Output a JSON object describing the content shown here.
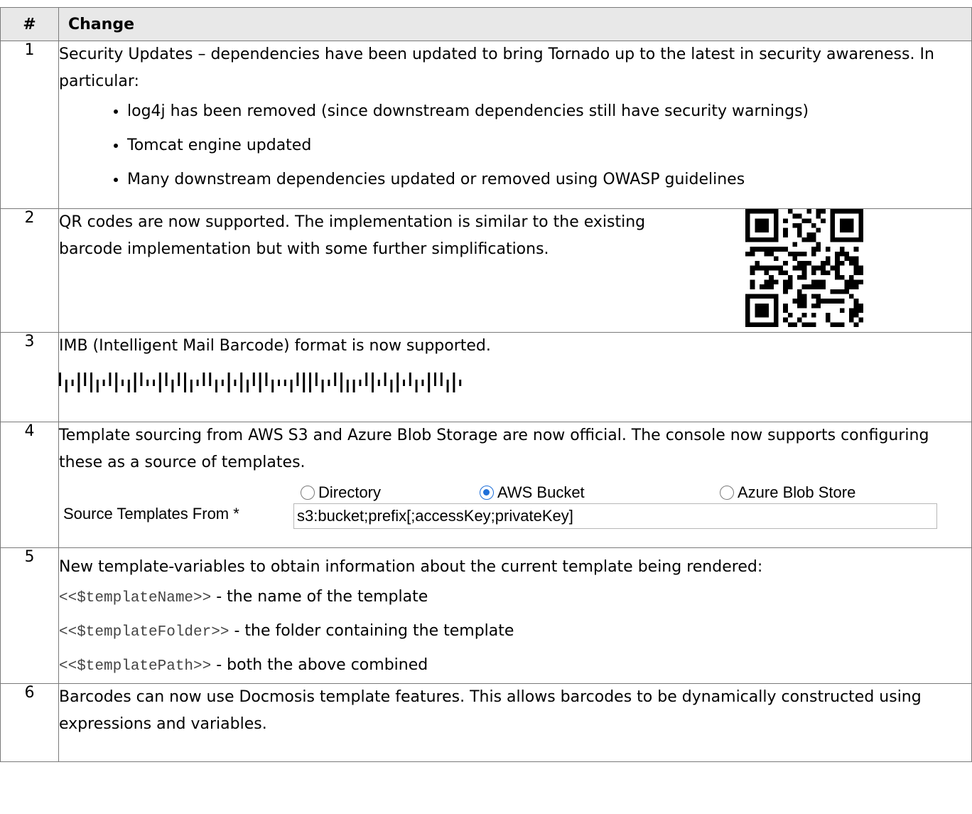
{
  "table": {
    "headers": {
      "num": "#",
      "change": "Change"
    },
    "rows": [
      {
        "num": "1",
        "text": "Security Updates – dependencies have been updated to bring Tornado up to the latest in security awareness.  In particular:",
        "bullets": [
          "log4j has been removed (since downstream dependencies still have security warnings)",
          "Tomcat engine updated",
          "Many downstream dependencies updated or removed using OWASP guidelines"
        ]
      },
      {
        "num": "2",
        "text": "QR codes are now supported.  The implementation is similar to the existing barcode implementation but with some further simplifications."
      },
      {
        "num": "3",
        "text": "IMB (Intelligent Mail Barcode) format is now supported."
      },
      {
        "num": "4",
        "text": "Template sourcing from AWS S3 and Azure Blob Storage are now official.  The console now supports configuring these as a source of templates.",
        "form": {
          "label": "Source Templates From *",
          "options": [
            "Directory",
            "AWS Bucket",
            "Azure Blob Store"
          ],
          "selected": "AWS Bucket",
          "input_value": "s3:bucket;prefix[;accessKey;privateKey]"
        }
      },
      {
        "num": "5",
        "text": "New template-variables to obtain information about the current template being rendered:",
        "vars": [
          {
            "code": "<<$templateName>>",
            "desc": " - the name of the template"
          },
          {
            "code": "<<$templateFolder>>",
            "desc": " - the folder containing the template"
          },
          {
            "code": "<<$templatePath>>",
            "desc": " - both the above combined"
          }
        ]
      },
      {
        "num": "6",
        "text": "Barcodes can now use Docmosis template features.  This allows barcodes to be dynamically constructed using expressions and variables."
      }
    ]
  },
  "colors": {
    "radio_selected": "#1e6fd9",
    "header_bg": "#e8e8e8",
    "border": "#7a7a7a"
  }
}
